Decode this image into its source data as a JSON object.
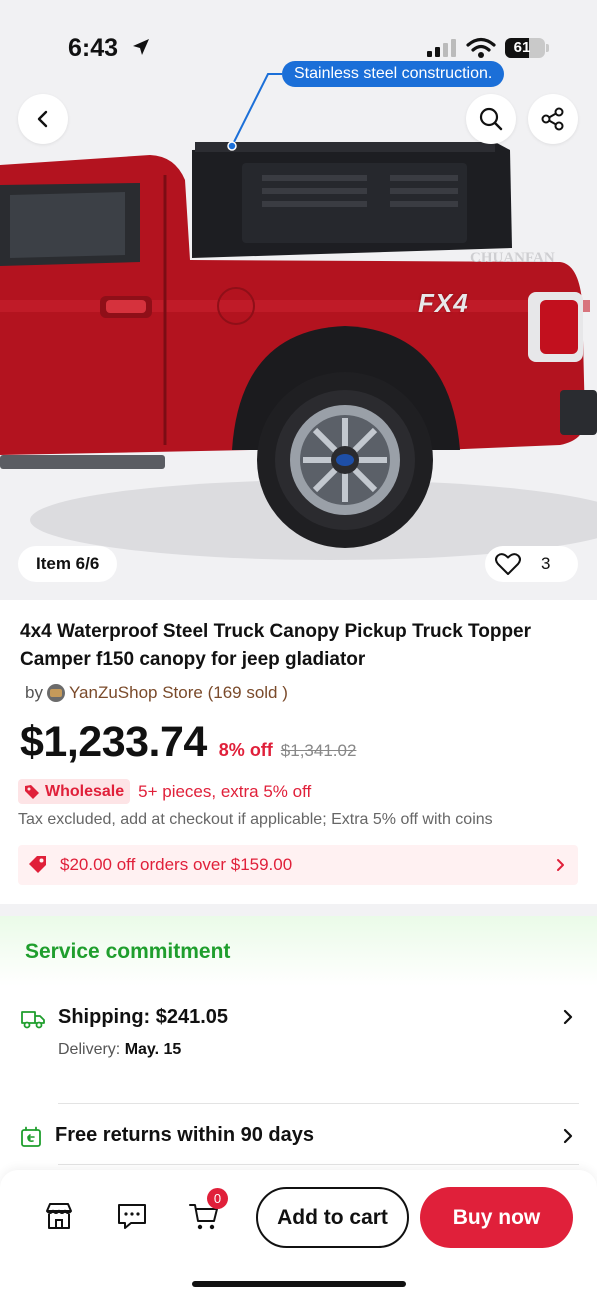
{
  "status_bar": {
    "time": "6:43",
    "battery": "61"
  },
  "hero": {
    "callout": "Stainless steel construction.",
    "watermark": "CHUANFAN",
    "badge_text": "FX4",
    "item_counter": "Item 6/6",
    "likes": "3"
  },
  "product": {
    "title": "4x4 Waterproof Steel Truck Canopy Pickup Truck Topper Camper f150 canopy for jeep gladiator",
    "by": "by",
    "store": "YanZuShop Store (169 sold )",
    "price": "$1,233.74",
    "discount": "8% off",
    "original_price": "$1,341.02",
    "wholesale_tag": "Wholesale",
    "wholesale_offer": "5+ pieces, extra 5% off",
    "tax_note": "Tax excluded, add at checkout if applicable; Extra 5% off with coins",
    "coupon": "$20.00 off orders over $159.00"
  },
  "service": {
    "title": "Service commitment",
    "shipping_label": "Shipping: $241.05",
    "delivery_prefix": "Delivery:",
    "delivery_date": "May. 15",
    "returns_label": "Free returns within 90 days"
  },
  "bottom_bar": {
    "cart_count": "0",
    "add_to_cart": "Add to cart",
    "buy_now": "Buy now"
  },
  "colors": {
    "accent_red": "#e0203a",
    "service_green": "#1f9e2d",
    "callout_blue": "#1b6fd8",
    "truck_red": "#b3131f"
  }
}
